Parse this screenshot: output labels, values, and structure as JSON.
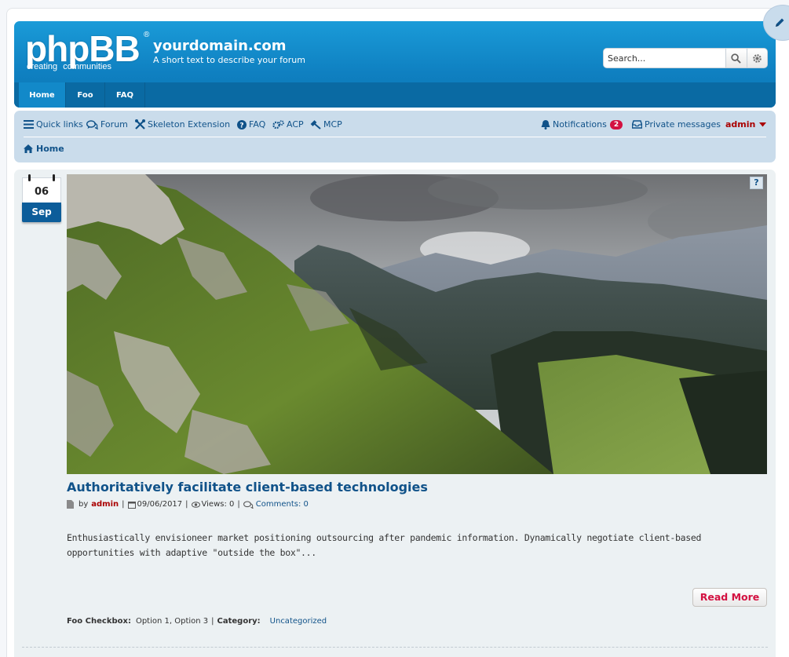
{
  "header": {
    "logo_word": "phpBB",
    "logo_reg": "®",
    "logo_tag_1": "creating",
    "logo_tag_2": "communities",
    "site_name": "yourdomain.com",
    "site_desc": "A short text to describe your forum",
    "search_placeholder": "Search...",
    "search_icon": "magnifier-icon",
    "advanced_search_icon": "gear-icon",
    "tabs": [
      {
        "label": "Home",
        "active": true
      },
      {
        "label": "Foo",
        "active": false
      },
      {
        "label": "FAQ",
        "active": false
      }
    ]
  },
  "navbar": {
    "quick_links": "Quick links",
    "forum": "Forum",
    "skeleton": "Skeleton Extension",
    "faq": "FAQ",
    "acp": "ACP",
    "mcp": "MCP",
    "notifications": "Notifications",
    "notifications_count": "2",
    "private_messages": "Private messages",
    "username": "admin",
    "breadcrumb_home": "Home"
  },
  "post": {
    "day": "06",
    "month": "Sep",
    "help": "?",
    "title": "Authoritatively facilitate client-based technologies",
    "by": "by",
    "author": "admin",
    "date": "09/06/2017",
    "views": "Views: 0",
    "comments": "Comments: 0",
    "body": "Enthusiastically envisioneer market positioning outsourcing after pandemic information. Dynamically negotiate client-based opportunities with adaptive \"outside the box\"...",
    "read_more": "Read More",
    "field_label": "Foo Checkbox:",
    "field_value": "Option 1, Option 3",
    "category_label": "Category:",
    "category_value": "Uncategorized"
  },
  "colors": {
    "header_blue": "#0f80c1",
    "link_blue": "#105289",
    "admin_red": "#aa0000",
    "badge_red": "#d31141"
  }
}
